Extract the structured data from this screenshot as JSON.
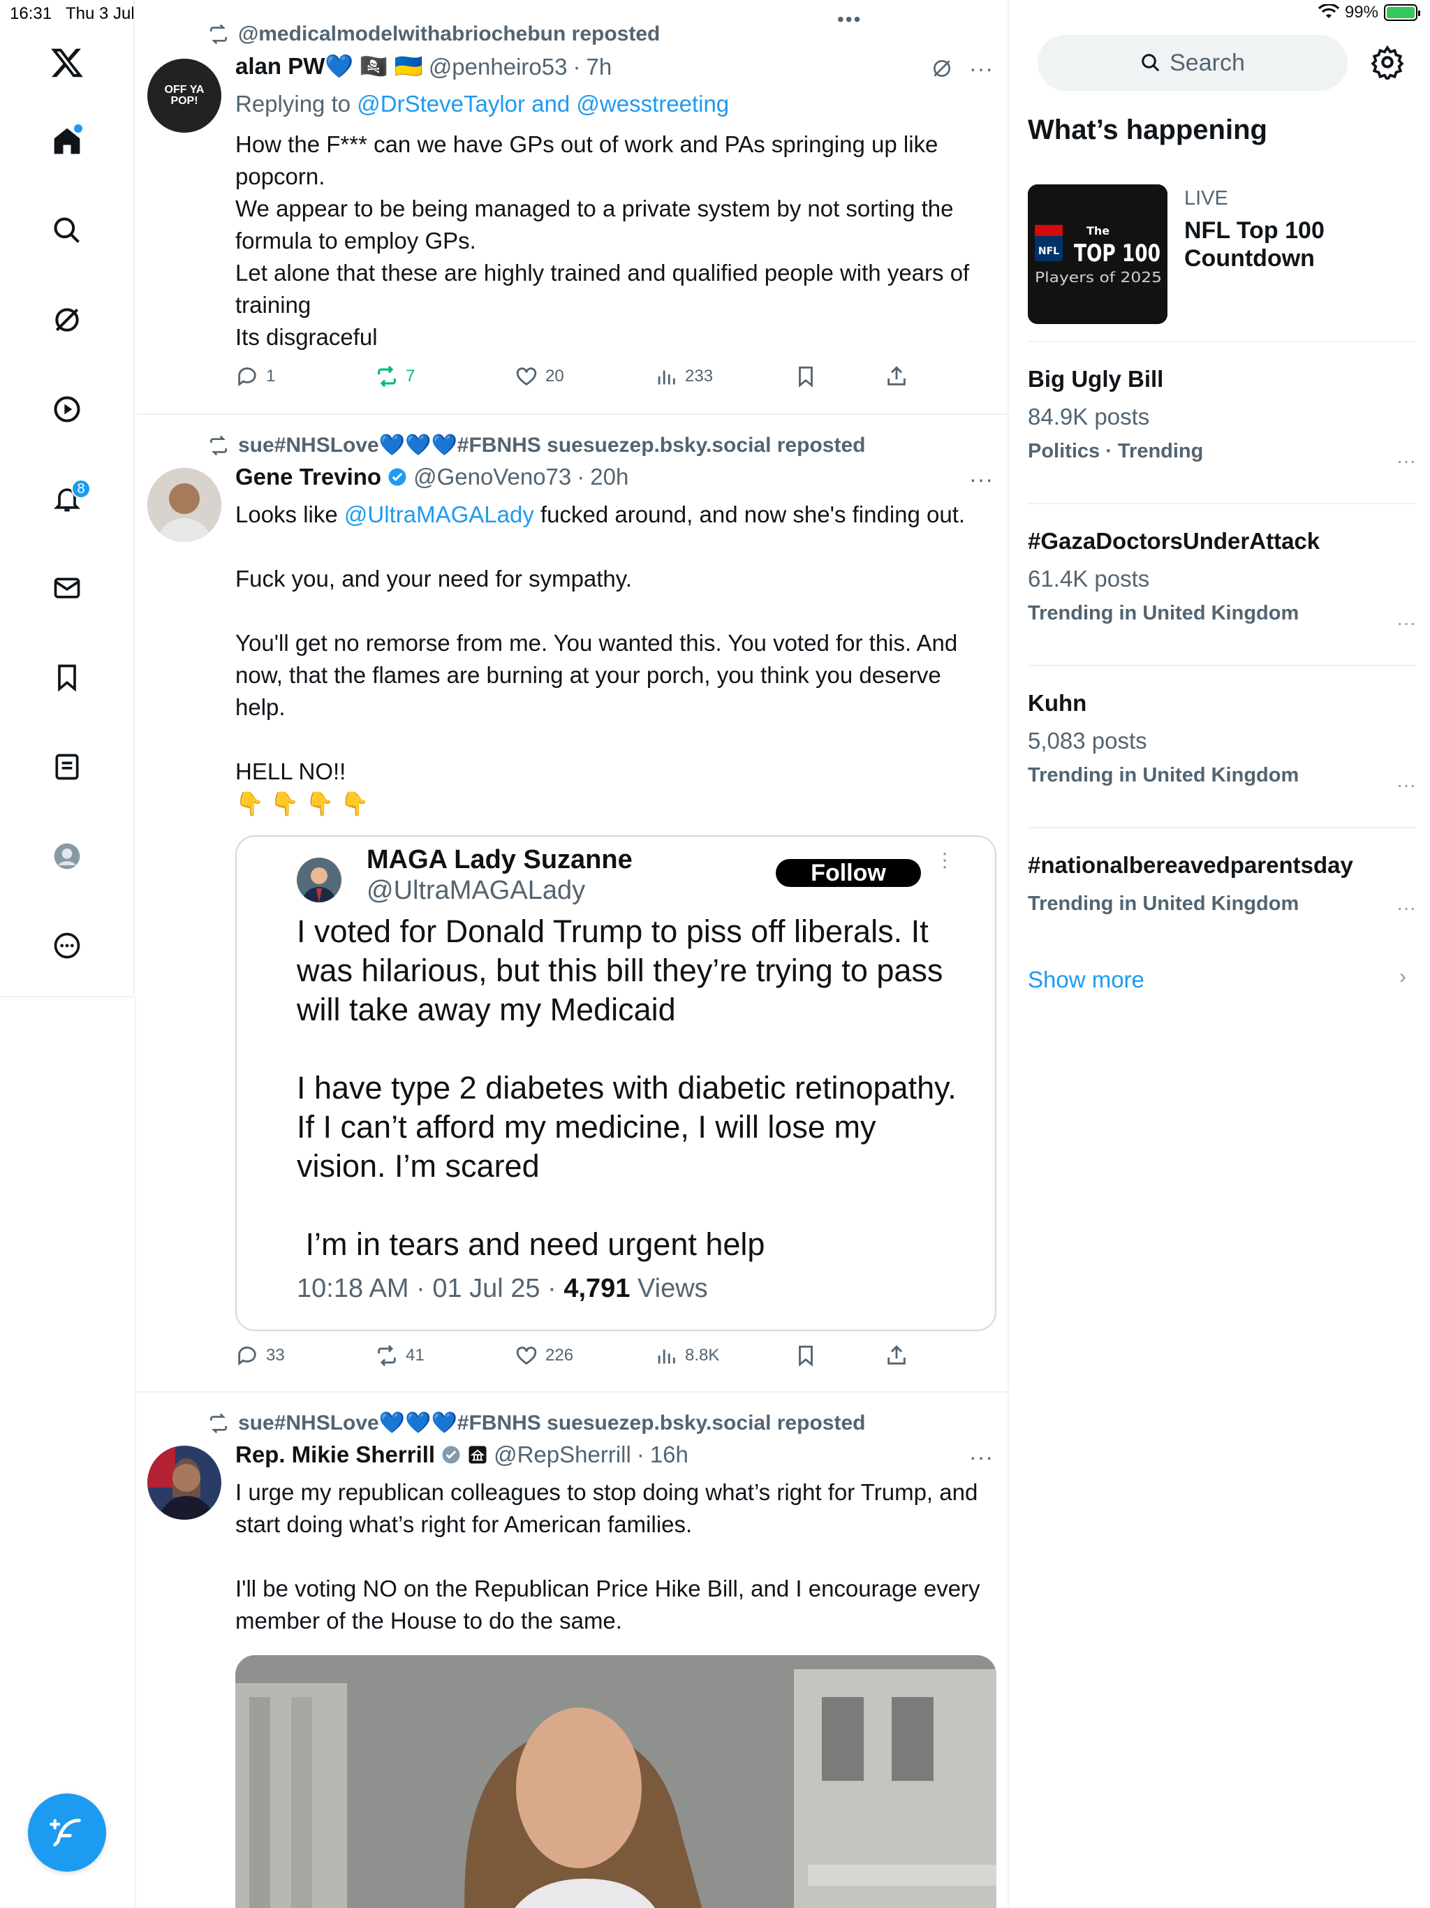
{
  "status_bar": {
    "time": "16:31",
    "date": "Thu 3 Jul",
    "battery": "99%",
    "battery_level": 0.99
  },
  "nav": {
    "notifications_badge": "8"
  },
  "posts": [
    {
      "repost_by": "@medicalmodelwithabriochebun reposted",
      "name": "alan PW💙",
      "name_emoji": "🏴‍☠️ 🇺🇦",
      "handle": "@penheiro53",
      "time": "7h",
      "avatar_text": "OFF YA POP!",
      "reply_prefix": "Replying to ",
      "reply_users": "@DrSteveTaylor and @wesstreeting",
      "text": "How the F*** can we have GPs out of work and PAs springing up like popcorn.\nWe appear to be being managed to a private system by not sorting the formula to employ GPs.\nLet alone that these are highly trained and qualified people with years of training\nIts disgraceful",
      "replies": "1",
      "reposts": "7",
      "likes": "20",
      "views": "233"
    },
    {
      "repost_by": "sue#NHSLove💙💙💙#FBNHS suesuezep.bsky.social reposted",
      "name": "Gene Trevino",
      "handle": "@GenoVeno73",
      "time": "20h",
      "text_prefix": "Looks like ",
      "text_mention": "@UltraMAGALady",
      "text_rest": " fucked around, and now she's finding out.\n\nFuck you, and your need for sympathy.\n\nYou'll get no remorse from me. You wanted this. You voted for this. And now, that the flames are burning at your porch, you think you deserve help.\n\nHELL NO!!\n👇 👇 👇 👇",
      "quote": {
        "name": "MAGA Lady Suzanne",
        "handle": "@UltraMAGALady",
        "follow_label": "Follow",
        "text": "I voted for Donald Trump to piss off liberals. It was hilarious, but this bill they’re trying to pass will take away my Medicaid\n\nI have type 2 diabetes with diabetic retinopathy. If I can’t afford my medicine, I will lose my vision. I’m scared\n\n I’m in tears and need urgent help",
        "meta_time": "10:18 AM · 01 Jul 25 · ",
        "meta_views": "4,791",
        "meta_views_label": " Views"
      },
      "replies": "33",
      "reposts": "41",
      "likes": "226",
      "views": "8.8K"
    },
    {
      "repost_by": "sue#NHSLove💙💙💙#FBNHS suesuezep.bsky.social reposted",
      "name": "Rep. Mikie Sherrill",
      "handle": "@RepSherrill",
      "time": "16h",
      "text": "I urge my republican colleagues to stop doing what’s right for Trump, and start doing what’s right for American families.\n\nI'll be voting NO on the Republican Price Hike Bill, and I encourage every member of the House to do the same."
    }
  ],
  "sidebar": {
    "search_placeholder": "Search",
    "section_title": "What’s happening",
    "live_label": "LIVE",
    "live_title": "NFL Top 100 Countdown",
    "live_thumb_line1": "The",
    "live_thumb_line2": "TOP 100",
    "live_thumb_line3": "Players of 2025",
    "live_thumb_logo": "NFL",
    "trends": [
      {
        "title": "Big Ugly Bill",
        "count": "84.9K posts",
        "context": "Politics · Trending"
      },
      {
        "title": "#GazaDoctorsUnderAttack",
        "count": "61.4K posts",
        "context": "Trending in United Kingdom"
      },
      {
        "title": "Kuhn",
        "count": "5,083 posts",
        "context": "Trending in United Kingdom"
      },
      {
        "title": "#nationalbereavedparentsday",
        "count": "",
        "context": "Trending in United Kingdom"
      }
    ],
    "show_more": "Show more"
  },
  "colors": {
    "accent": "#1d9bf0",
    "repost_green": "#00ba7c",
    "text": "#0f1419",
    "muted": "#536471"
  }
}
